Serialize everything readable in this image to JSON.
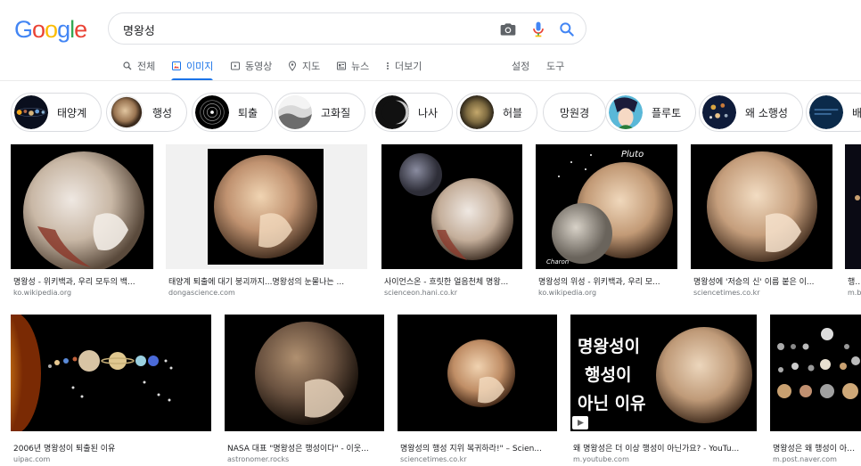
{
  "logo": [
    "G",
    "o",
    "o",
    "g",
    "l",
    "e"
  ],
  "logo_colors": [
    "#4285F4",
    "#EA4335",
    "#FBBC05",
    "#4285F4",
    "#34A853",
    "#EA4335"
  ],
  "search": {
    "query": "명왕성"
  },
  "nav": {
    "tabs": [
      {
        "label": "전체",
        "icon": "search-icon"
      },
      {
        "label": "이미지",
        "icon": "image-icon",
        "active": true
      },
      {
        "label": "동영상",
        "icon": "video-icon"
      },
      {
        "label": "지도",
        "icon": "map-pin-icon"
      },
      {
        "label": "뉴스",
        "icon": "news-icon"
      },
      {
        "label": "더보기",
        "icon": "more-vert-icon"
      }
    ],
    "settings": "설정",
    "tools": "도구"
  },
  "chips": [
    {
      "label": "태양계",
      "thumb": "solar-system"
    },
    {
      "label": "행성",
      "thumb": "pluto"
    },
    {
      "label": "퇴출",
      "thumb": "orbits"
    },
    {
      "label": "고화질",
      "thumb": "surface"
    },
    {
      "label": "나사",
      "thumb": "dark-planet"
    },
    {
      "label": "허블",
      "thumb": "hubble"
    },
    {
      "label": "망원경",
      "thumb": null
    },
    {
      "label": "플루토",
      "thumb": "anime"
    },
    {
      "label": "왜 소행성",
      "thumb": "dwarf"
    },
    {
      "label": "배",
      "thumb": "blue"
    }
  ],
  "results_row1": [
    {
      "title": "명왕성 - 위키백과, 우리 모두의 백...",
      "source": "ko.wikipedia.org"
    },
    {
      "title": "태양계 퇴출에 대기 붕괴까지...명왕성의 눈물나는 ...",
      "source": "dongascience.com"
    },
    {
      "title": "사이언스온 - 흐릿한 얼음천체 명왕...",
      "source": "scienceon.hani.co.kr"
    },
    {
      "title": "명왕성의 위성 - 위키백과, 우리 모...",
      "source": "ko.wikipedia.org",
      "labels": [
        "Pluto",
        "Charon"
      ]
    },
    {
      "title": "명왕성에 '저승의 신' 이름 붙은 이...",
      "source": "sciencetimes.co.kr"
    },
    {
      "title": "행성",
      "source": "m.b"
    }
  ],
  "results_row2": [
    {
      "title": "2006년 명왕성이 퇴출된 이유",
      "source": "uipac.com"
    },
    {
      "title": "NASA 대표 \"명왕성은 행성이다\" - 이웃...",
      "source": "astronomer.rocks"
    },
    {
      "title": "명왕성의 행성 지위 복귀하라!\" – Scien...",
      "source": "sciencetimes.co.kr"
    },
    {
      "title": "왜 명왕성은 더 이상 행성이 아닌가요? - YouTu...",
      "source": "m.youtube.com",
      "overlay": [
        "명왕성이",
        "행성이",
        "아닌 이유"
      ]
    },
    {
      "title": "명왕성은 왜 행성이 아닌 이유",
      "source": "m.post.naver.com"
    }
  ]
}
